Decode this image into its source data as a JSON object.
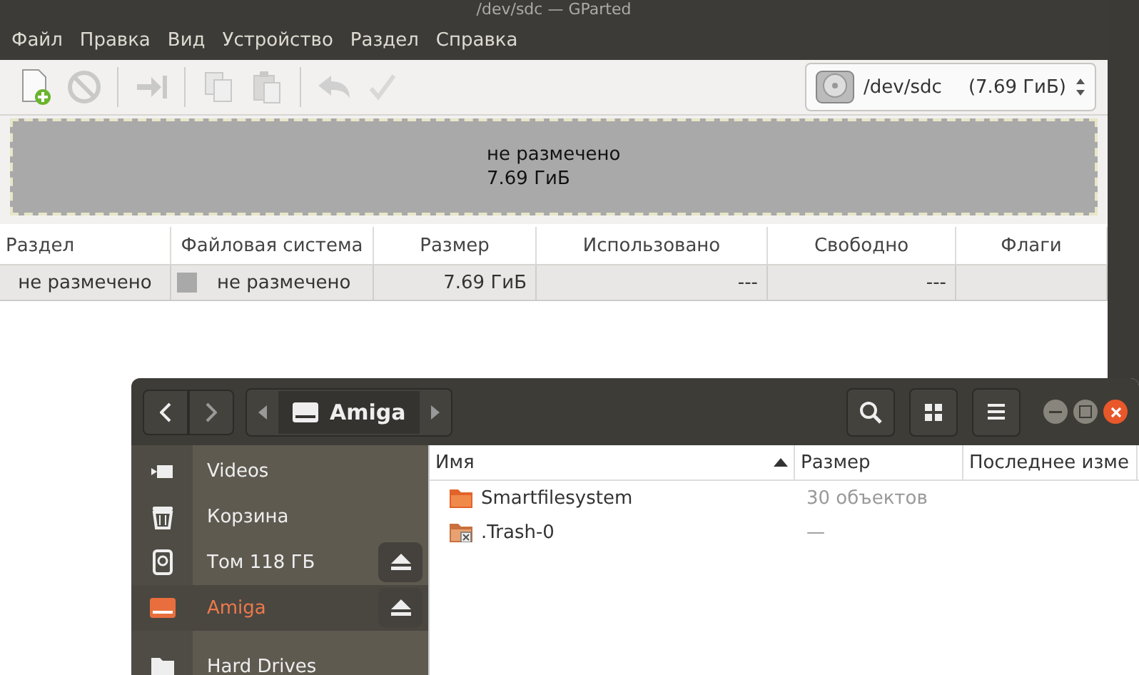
{
  "gparted": {
    "title": "/dev/sdc — GParted",
    "menu": [
      "Файл",
      "Правка",
      "Вид",
      "Устройство",
      "Раздел",
      "Справка"
    ],
    "toolbar": [
      {
        "kind": "new",
        "disabled": false
      },
      {
        "kind": "delete",
        "disabled": true
      },
      {
        "kind": "sep"
      },
      {
        "kind": "resize",
        "disabled": true
      },
      {
        "kind": "sep"
      },
      {
        "kind": "copy",
        "disabled": true
      },
      {
        "kind": "paste",
        "disabled": true
      },
      {
        "kind": "sep"
      },
      {
        "kind": "undo",
        "disabled": true
      },
      {
        "kind": "apply",
        "disabled": true
      }
    ],
    "device": {
      "path": "/dev/sdc",
      "size": "(7.69 ГиБ)"
    },
    "graph": {
      "label": "не размечено",
      "size": "7.69 ГиБ"
    },
    "table": {
      "columns": [
        "Раздел",
        "Файловая система",
        "Размер",
        "Использовано",
        "Свободно",
        "Флаги"
      ],
      "rows": [
        {
          "selected": true,
          "color": "#a9a9a9",
          "cells": [
            "не размечено",
            "не размечено",
            "7.69 ГиБ",
            "---",
            "---",
            ""
          ]
        }
      ]
    }
  },
  "files": {
    "path": "Amiga",
    "sidebar": [
      {
        "label": "Videos",
        "kind": "video",
        "selected": false,
        "eject": false
      },
      {
        "label": "Корзина",
        "kind": "trash",
        "selected": false,
        "eject": false
      },
      {
        "label": "Том 118 ГБ",
        "kind": "disk",
        "selected": false,
        "eject": true
      },
      {
        "label": "Amiga",
        "kind": "drive",
        "selected": true,
        "eject": true
      },
      {
        "label": "Hard Drives",
        "kind": "folder",
        "selected": false,
        "eject": false
      }
    ],
    "columns": [
      "Имя",
      "Размер",
      "Последнее изме"
    ],
    "rows": [
      {
        "kind": "folder",
        "name": "Smartfilesystem",
        "size": "30 объектов"
      },
      {
        "kind": "locked-folder",
        "name": ".Trash-0",
        "size": "—"
      }
    ]
  }
}
